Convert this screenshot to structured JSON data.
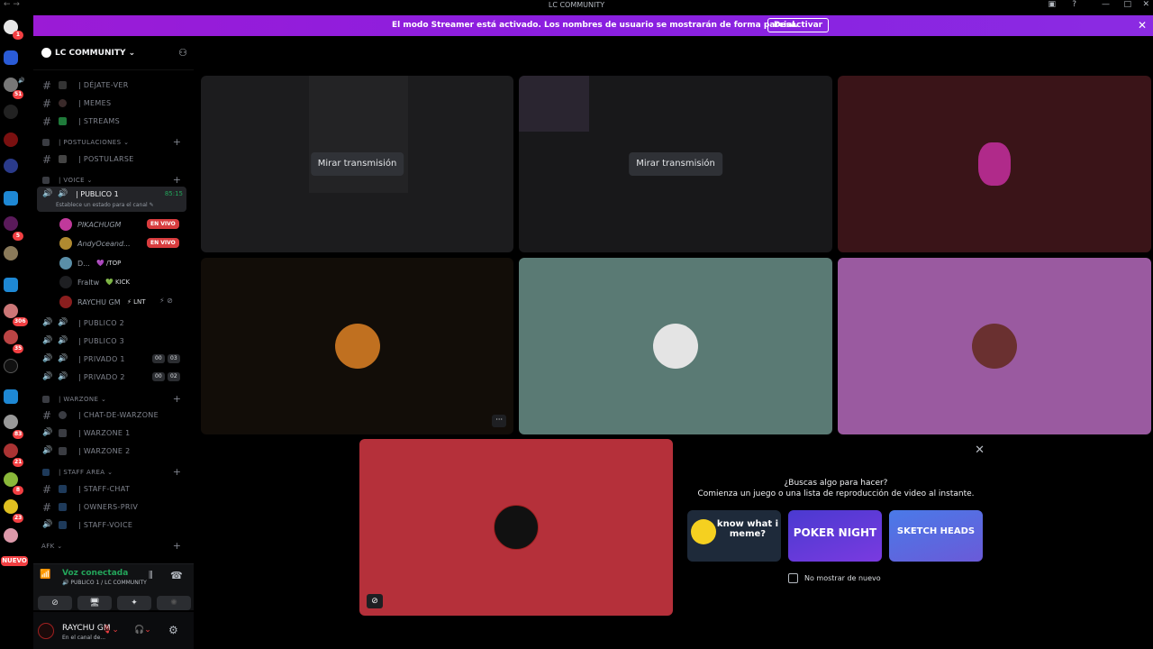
{
  "titlebar": {
    "title": "LC COMMUNITY",
    "nav": "← →"
  },
  "banner": {
    "message": "El modo Streamer está activado. Los nombres de usuario se mostrarán de forma parcial.",
    "button": "Desactivar",
    "close": "✕"
  },
  "server_rail": {
    "badges": [
      "1",
      "51",
      "5",
      "306",
      "35",
      "83",
      "21",
      "8",
      "23"
    ],
    "nuevo": "NUEVO"
  },
  "guild": {
    "name": "LC COMMUNITY",
    "chevron": "⌄"
  },
  "channels": {
    "dejate_ver": "| DÉJATE-VER",
    "memes": "| MEMES",
    "streams": "| STREAMS",
    "cat_postulaciones": "| POSTULACIONES ⌄",
    "postularse": "| POSTULARSE",
    "cat_voice": "| VOICE ⌄",
    "publico1": "| PUBLICO 1",
    "publico1_time": "85:15",
    "publico1_status": "Establece un estado para el canal ✎",
    "publico2": "| PUBLICO 2",
    "publico3": "| PUBLICO 3",
    "privado1": "| PRIVADO 1",
    "privado1_a": "00",
    "privado1_b": "03",
    "privado2": "| PRIVADO 2",
    "privado2_a": "00",
    "privado2_b": "02",
    "cat_warzone": "| WARZONE ⌄",
    "chat_warzone": "| CHAT-DE-WARZONE",
    "warzone1": "| WARZONE 1",
    "warzone2": "| WARZONE 2",
    "cat_staff": "| STAFF AREA ⌄",
    "staff_chat": "| STAFF-CHAT",
    "owners_priv": "| OWNERS-PRIV",
    "staff_voice": "| STAFF-VOICE",
    "cat_afk": "AFK ⌄"
  },
  "voice_users": [
    {
      "name": "PIKACHUGM",
      "tag": "EN VIVO",
      "color": "#c0399b"
    },
    {
      "name": "AndyOceand...",
      "tag": "EN VIVO",
      "color": "#b08a30"
    },
    {
      "name": "D...",
      "tag": "💜 /TOP",
      "color": "#5a8fa8"
    },
    {
      "name": "Fraltw",
      "tag": "💚 KICK",
      "color": "#1e1f22"
    },
    {
      "name": "RAYCHU GM",
      "tag": "⚡ LNT",
      "color": "#8a1e1e"
    }
  ],
  "voice_panel": {
    "status": "Voz conectada",
    "location": "PUBLICO 1 / LC COMMUNITY"
  },
  "user_panel": {
    "name": "RAYCHU GM",
    "status": "En el canal de..."
  },
  "stage": {
    "watch_label": "Mirar transmisión",
    "more": "···"
  },
  "activity": {
    "title": "¿Buscas algo para hacer?",
    "subtitle": "Comienza un juego o una lista de reproducción de video al instante.",
    "cards": [
      "know what i meme?",
      "POKER NIGHT",
      "SKETCH HEADS"
    ],
    "checkbox_label": "No mostrar de nuevo",
    "close": "✕"
  },
  "colors": {
    "banner": "#8a1fe0",
    "tile_dark": "#1c1c1e",
    "tile_teal": "#5a7a74",
    "tile_maroon": "#3a1418",
    "tile_purple": "#9a5aa0",
    "tile_red": "#b5303a",
    "live": "#d83c3e",
    "connected": "#23a55a"
  }
}
